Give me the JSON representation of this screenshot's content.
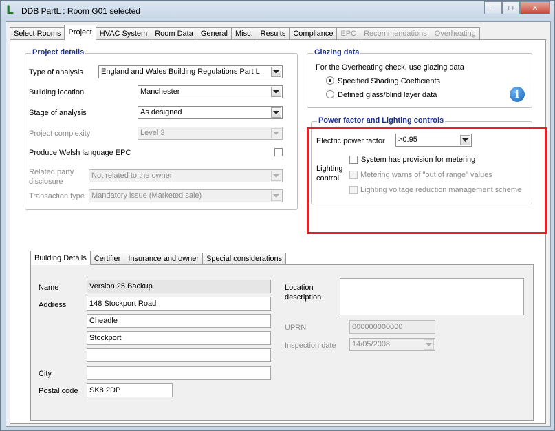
{
  "window": {
    "title": "DDB PartL : Room G01 selected",
    "icon_letter": "L",
    "minimize": "−",
    "maximize": "□",
    "close": "✕"
  },
  "tabs": [
    {
      "label": "Select Rooms",
      "state": "normal"
    },
    {
      "label": "Project",
      "state": "active"
    },
    {
      "label": "HVAC System",
      "state": "normal"
    },
    {
      "label": "Room Data",
      "state": "normal"
    },
    {
      "label": "General",
      "state": "normal"
    },
    {
      "label": "Misc.",
      "state": "normal"
    },
    {
      "label": "Results",
      "state": "normal"
    },
    {
      "label": "Compliance",
      "state": "normal"
    },
    {
      "label": "EPC",
      "state": "disabled"
    },
    {
      "label": "Recommendations",
      "state": "disabled"
    },
    {
      "label": "Overheating",
      "state": "disabled"
    }
  ],
  "project_details": {
    "title": "Project details",
    "type_of_analysis_label": "Type of analysis",
    "type_of_analysis_value": "England and Wales Building Regulations Part L",
    "building_location_label": "Building location",
    "building_location_value": "Manchester",
    "stage_label": "Stage of analysis",
    "stage_value": "As designed",
    "complexity_label": "Project complexity",
    "complexity_value": "Level 3",
    "welsh_epc_label": "Produce Welsh language EPC",
    "welsh_epc_checked": false,
    "related_party_label_1": "Related party",
    "related_party_label_2": "disclosure",
    "related_party_value": "Not related to the owner",
    "transaction_label": "Transaction type",
    "transaction_value": "Mandatory issue (Marketed sale)"
  },
  "glazing": {
    "title": "Glazing data",
    "description": "For the Overheating check, use glazing data",
    "option_1": "Specified Shading Coefficients",
    "option_2": "Defined glass/blind layer data",
    "selected": "option_1"
  },
  "power": {
    "title": "Power factor and Lighting controls",
    "power_factor_label": "Electric power factor",
    "power_factor_value": ">0.95",
    "lighting_label_1": "Lighting",
    "lighting_label_2": "control",
    "check_metering": "System has provision for metering",
    "check_warns": "Metering warns of \"out of range\" values",
    "check_voltage": "Lighting voltage reduction management scheme"
  },
  "subtabs": [
    {
      "label": "Building Details",
      "state": "active"
    },
    {
      "label": "Certifier",
      "state": "normal"
    },
    {
      "label": "Insurance and owner",
      "state": "normal"
    },
    {
      "label": "Special considerations",
      "state": "normal"
    }
  ],
  "building": {
    "name_label": "Name",
    "name_value": "Version 25 Backup",
    "address_label": "Address",
    "address_1": "148 Stockport Road",
    "address_2": "Cheadle",
    "address_3": "Stockport",
    "address_4": "",
    "city_label": "City",
    "city_value": "",
    "postal_label": "Postal code",
    "postal_value": "SK8 2DP",
    "location_label_1": "Location",
    "location_label_2": "description",
    "uprn_label": "UPRN",
    "uprn_value": "000000000000",
    "inspection_label": "Inspection date",
    "inspection_value": "14/05/2008"
  },
  "colors": {
    "group_title": "#1c2f8c",
    "highlight": "#e12228",
    "disabled_text": "#8d8d8d"
  }
}
